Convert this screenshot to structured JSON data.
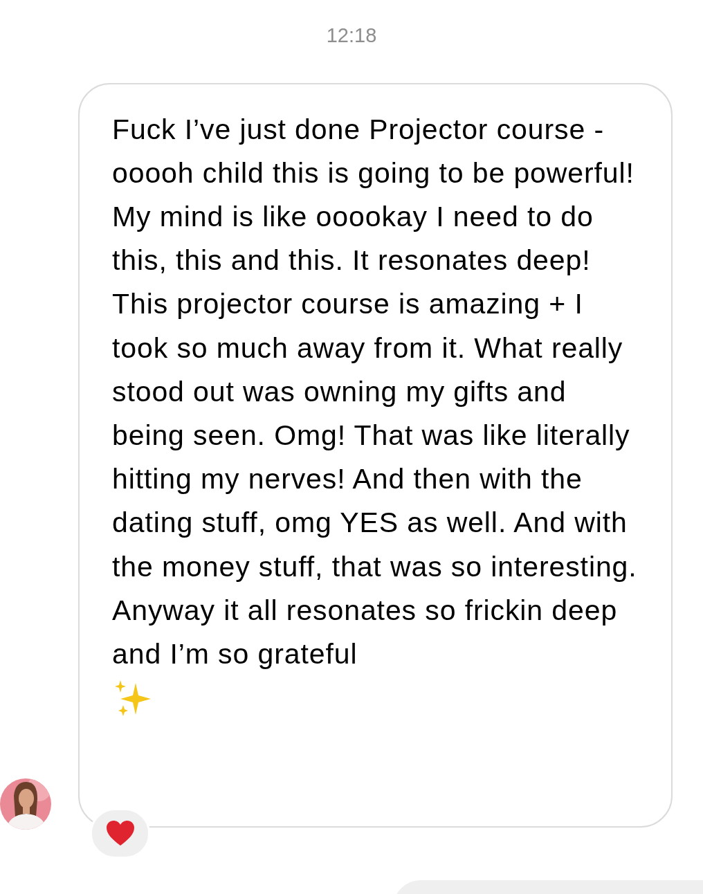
{
  "timestamp": "12:18",
  "message": {
    "text": "Fuck I’ve just done Projector course - ooooh child this is going to be powerful! My mind is like ooookay I need to do this, this and this. It resonates deep! This projector course is amazing + I took so much away from it. What really stood out was owning my gifts and being seen. Omg! That was like literally hitting my nerves! And then with the dating stuff, omg YES as well. And with the money stuff, that was so interesting. Anyway it all resonates so frickin deep and I’m so grateful",
    "reacted": true
  }
}
